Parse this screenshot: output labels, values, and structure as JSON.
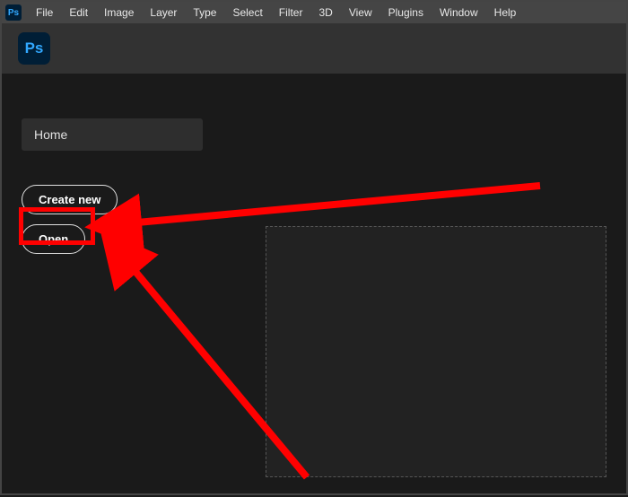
{
  "app": {
    "short_name": "Ps"
  },
  "menu": {
    "items": [
      "File",
      "Edit",
      "Image",
      "Layer",
      "Type",
      "Select",
      "Filter",
      "3D",
      "View",
      "Plugins",
      "Window",
      "Help"
    ]
  },
  "home": {
    "label": "Home",
    "create_new_label": "Create new",
    "open_label": "Open"
  },
  "annotation": {
    "highlight_target": "open-button",
    "color": "#ff0000"
  }
}
